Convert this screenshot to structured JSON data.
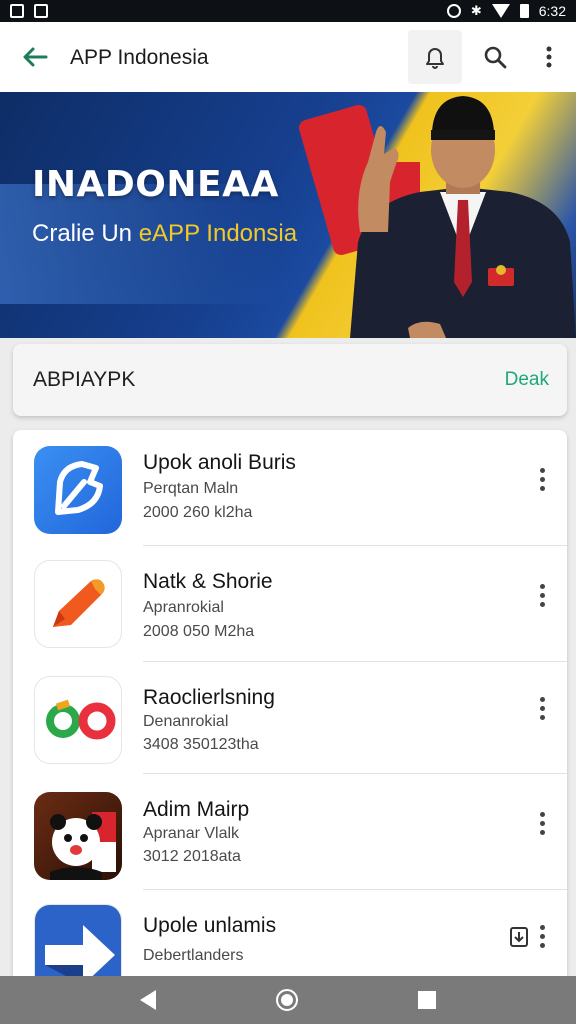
{
  "status_bar": {
    "time": "6:32"
  },
  "app_bar": {
    "title": "APP Indonesia"
  },
  "banner": {
    "headline": "INADONEAA",
    "subtitle_prefix": "Cralie Un ",
    "subtitle_highlight": "eAPP",
    "subtitle_suffix": " Indonsia"
  },
  "search": {
    "text": "ABPIAYPK",
    "action": "Deak"
  },
  "apps": [
    {
      "name": "Upok anoli Buris",
      "line1": "Perqtan Maln",
      "line2": "2000 260 kl2ha"
    },
    {
      "name": "Natk & Shorie",
      "line1": "Apranrokial",
      "line2": "2008 050 M2ha"
    },
    {
      "name": "Raoclierlsning",
      "line1": "Denanrokial",
      "line2": "3408 350123tha"
    },
    {
      "name": "Adim Mairp",
      "line1": "Apranar Vlalk",
      "line2": "3012 2018ata"
    },
    {
      "name": "Upole unlamis",
      "line1": "Debertlanders",
      "line2": ""
    }
  ],
  "colors": {
    "accent": "#1fa877",
    "back_arrow": "#1a7f58",
    "banner_blue": "#163f8e",
    "banner_yellow": "#f3cf38"
  }
}
